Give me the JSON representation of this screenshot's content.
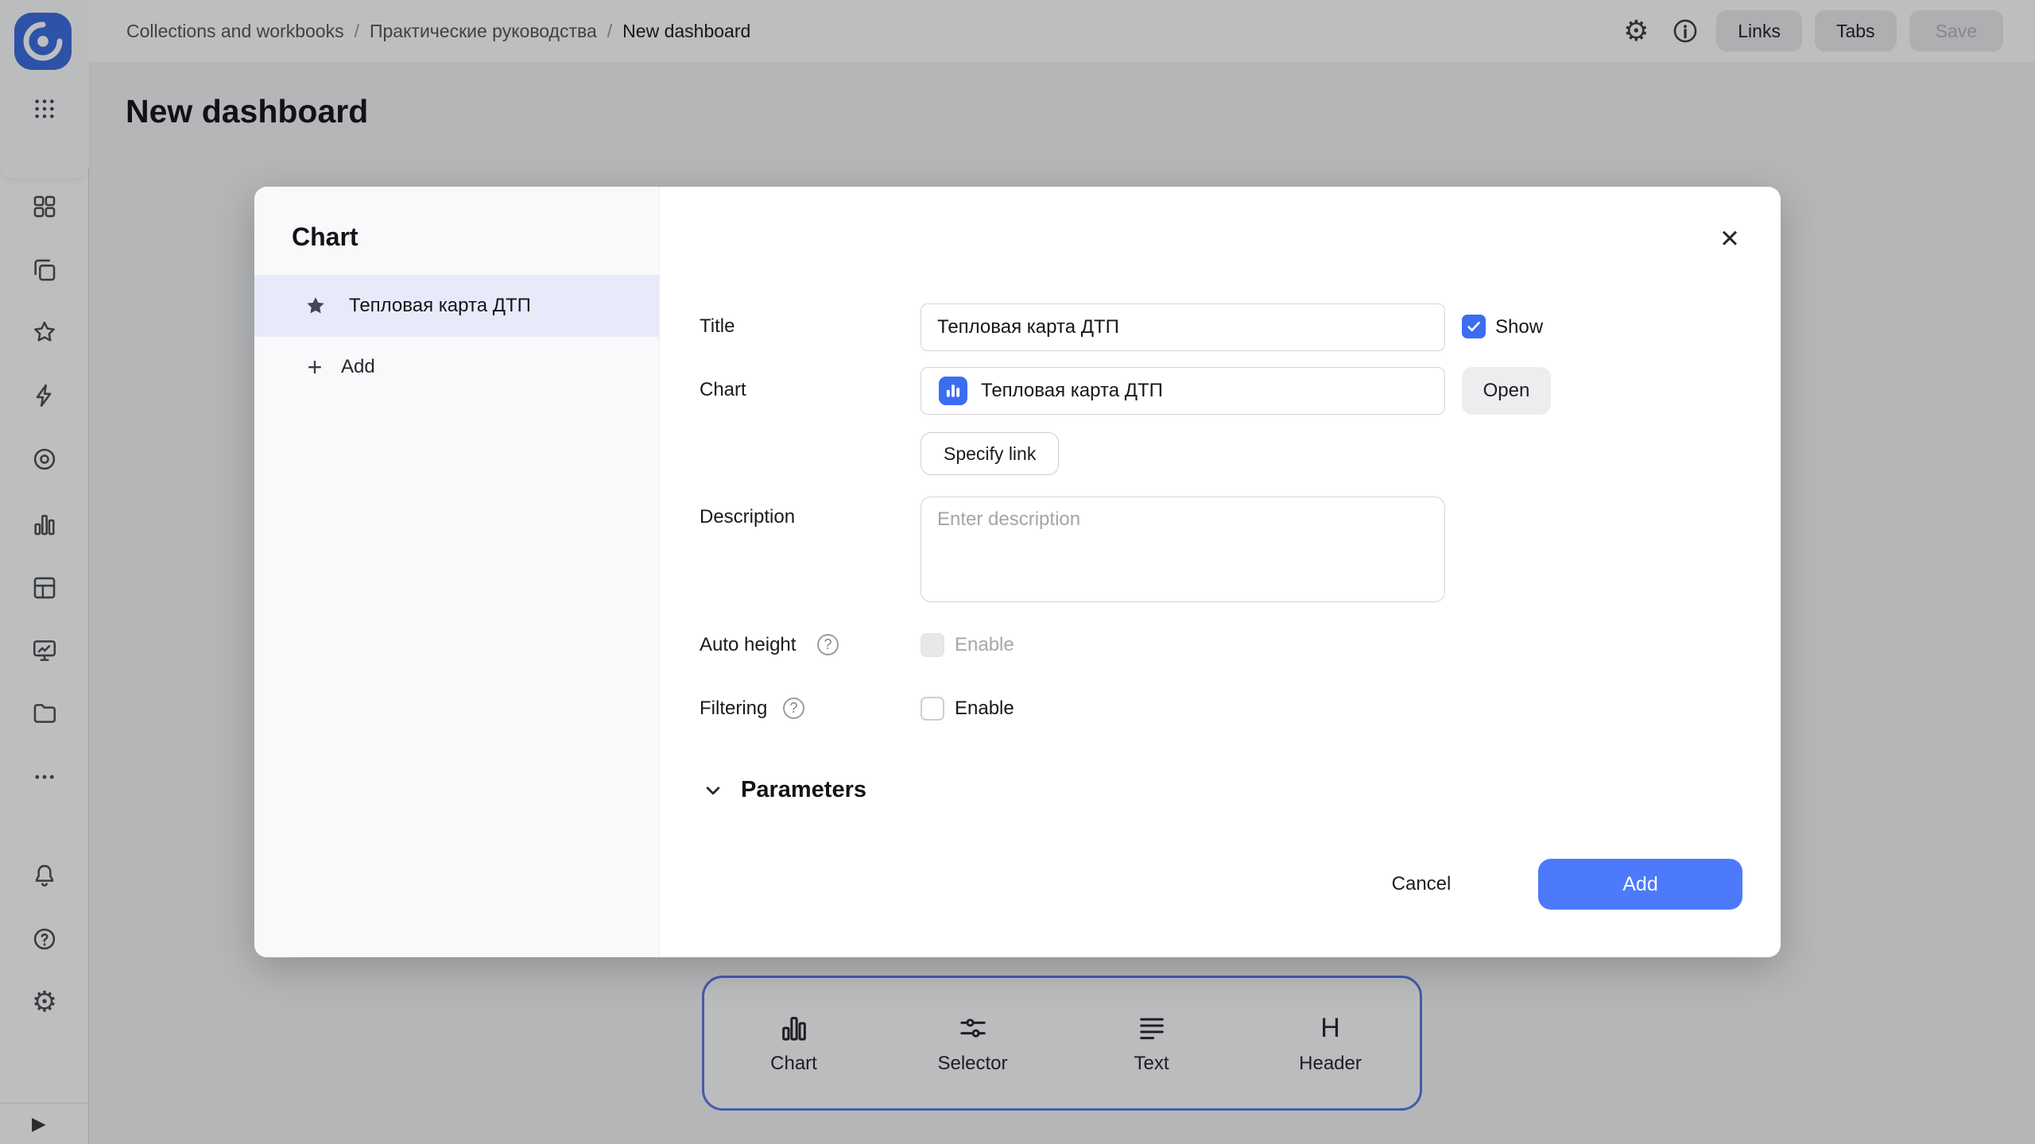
{
  "colors": {
    "accent_blue": "#4c7afa",
    "checkbox_blue": "#3a6df2",
    "selected_row_bg": "#e7ebf9",
    "toolbar_border_blue": "#5878ec",
    "logo_blue": "#3a6be0"
  },
  "icons": {
    "close": "✕",
    "plus": "+",
    "gear": "⚙",
    "question": "?",
    "expand": "▶",
    "header_glyph": "H"
  },
  "topbar": {
    "breadcrumbs": [
      {
        "label": "Collections and workbooks"
      },
      {
        "label": "Практические руководства"
      },
      {
        "label": "New dashboard"
      }
    ],
    "separator": "/",
    "links_button": "Links",
    "tabs_button": "Tabs",
    "save_button": "Save"
  },
  "page": {
    "title": "New dashboard"
  },
  "dialog": {
    "title": "Chart",
    "list": {
      "item": "Тепловая карта ДТП",
      "add": "Add"
    },
    "form": {
      "title_label": "Title",
      "title_value": "Тепловая карта ДТП",
      "show_label": "Show",
      "show_checked": true,
      "chart_label": "Chart",
      "chart_value": "Тепловая карта ДТП",
      "open_button": "Open",
      "specify_link_button": "Specify link",
      "description_label": "Description",
      "description_placeholder": "Enter description",
      "auto_height_label": "Auto height",
      "auto_height_enable": "Enable",
      "auto_height_checked": false,
      "auto_height_disabled": true,
      "filtering_label": "Filtering",
      "filtering_enable": "Enable",
      "filtering_checked": false,
      "parameters_label": "Parameters"
    },
    "footer": {
      "cancel": "Cancel",
      "add": "Add"
    }
  },
  "toolbar": {
    "items": [
      {
        "label": "Chart"
      },
      {
        "label": "Selector"
      },
      {
        "label": "Text"
      },
      {
        "label": "Header"
      }
    ]
  }
}
